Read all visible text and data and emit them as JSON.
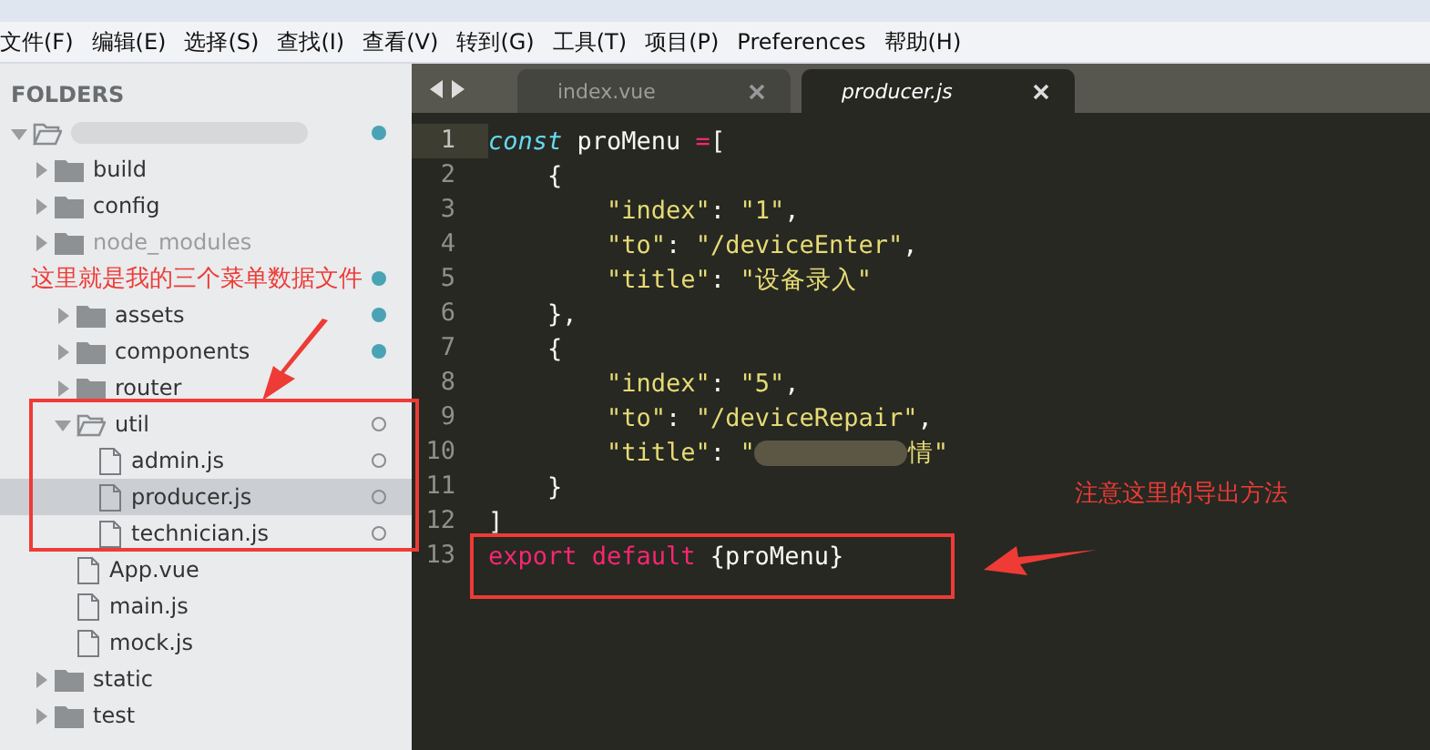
{
  "menu_bar": [
    "文件(F)",
    "编辑(E)",
    "选择(S)",
    "查找(I)",
    "查看(V)",
    "转到(G)",
    "工具(T)",
    "项目(P)",
    "Preferences",
    "帮助(H)"
  ],
  "sidebar": {
    "heading": "FOLDERS",
    "tree": [
      {
        "kind": "folder",
        "redacted": true,
        "expanded": true,
        "modified": true,
        "selected": false,
        "children": [
          {
            "kind": "folder",
            "label": "build",
            "expanded": false,
            "selected": false
          },
          {
            "kind": "folder",
            "label": "config",
            "expanded": false,
            "selected": false
          },
          {
            "kind": "folder",
            "label": "node_modules",
            "expanded": false,
            "dimmed": true,
            "selected": false
          },
          {
            "kind": "folder",
            "note": "这里就是我的三个菜单数据文件",
            "expanded": true,
            "modified": true,
            "selected": false,
            "children": [
              {
                "kind": "folder",
                "label": "assets",
                "expanded": false,
                "modified": true,
                "selected": false
              },
              {
                "kind": "folder",
                "label": "components",
                "expanded": false,
                "modified": true,
                "selected": false
              },
              {
                "kind": "folder",
                "label": "router",
                "expanded": false,
                "selected": false
              },
              {
                "kind": "folder",
                "label": "util",
                "expanded": true,
                "untracked": true,
                "selected": false,
                "children": [
                  {
                    "kind": "file",
                    "label": "admin.js",
                    "untracked": true,
                    "selected": false
                  },
                  {
                    "kind": "file",
                    "label": "producer.js",
                    "untracked": true,
                    "selected": true
                  },
                  {
                    "kind": "file",
                    "label": "technician.js",
                    "untracked": true,
                    "selected": false
                  }
                ]
              },
              {
                "kind": "file",
                "label": "App.vue",
                "selected": false
              },
              {
                "kind": "file",
                "label": "main.js",
                "selected": false
              },
              {
                "kind": "file",
                "label": "mock.js",
                "selected": false
              }
            ]
          },
          {
            "kind": "folder",
            "label": "static",
            "expanded": false,
            "selected": false
          },
          {
            "kind": "folder",
            "label": "test",
            "expanded": false,
            "selected": false
          }
        ]
      }
    ]
  },
  "tabs": [
    {
      "label": "index.vue",
      "selected": false
    },
    {
      "label": "producer.js",
      "selected": true
    }
  ],
  "editor": {
    "lines": [
      {
        "number": "1",
        "current": true,
        "tokens": [
          {
            "kind": "storage",
            "text": "const"
          },
          {
            "kind": "plain",
            "text": " proMenu "
          },
          {
            "kind": "operator",
            "text": "="
          },
          {
            "kind": "plain",
            "text": "["
          }
        ]
      },
      {
        "number": "2",
        "current": false,
        "tokens": [
          {
            "kind": "plain",
            "text": "    {"
          }
        ]
      },
      {
        "number": "3",
        "current": false,
        "tokens": [
          {
            "kind": "string",
            "text": "        \"index\""
          },
          {
            "kind": "plain",
            "text": ": "
          },
          {
            "kind": "string",
            "text": "\"1\""
          },
          {
            "kind": "plain",
            "text": ","
          }
        ]
      },
      {
        "number": "4",
        "current": false,
        "tokens": [
          {
            "kind": "string",
            "text": "        \"to\""
          },
          {
            "kind": "plain",
            "text": ": "
          },
          {
            "kind": "string",
            "text": "\"/deviceEnter\""
          },
          {
            "kind": "plain",
            "text": ","
          }
        ]
      },
      {
        "number": "5",
        "current": false,
        "tokens": [
          {
            "kind": "string",
            "text": "        \"title\""
          },
          {
            "kind": "plain",
            "text": ": "
          },
          {
            "kind": "string",
            "text": "\"设备录入\""
          }
        ]
      },
      {
        "number": "6",
        "current": false,
        "tokens": [
          {
            "kind": "plain",
            "text": "    },"
          }
        ]
      },
      {
        "number": "7",
        "current": false,
        "tokens": [
          {
            "kind": "plain",
            "text": "    {"
          }
        ]
      },
      {
        "number": "8",
        "current": false,
        "tokens": [
          {
            "kind": "string",
            "text": "        \"index\""
          },
          {
            "kind": "plain",
            "text": ": "
          },
          {
            "kind": "string",
            "text": "\"5\""
          },
          {
            "kind": "plain",
            "text": ","
          }
        ]
      },
      {
        "number": "9",
        "current": false,
        "tokens": [
          {
            "kind": "string",
            "text": "        \"to\""
          },
          {
            "kind": "plain",
            "text": ": "
          },
          {
            "kind": "string",
            "text": "\"/deviceRepair\""
          },
          {
            "kind": "plain",
            "text": ","
          }
        ]
      },
      {
        "number": "10",
        "current": false,
        "tokens": [
          {
            "kind": "string",
            "text": "        \"title\""
          },
          {
            "kind": "plain",
            "text": ": "
          },
          {
            "kind": "string",
            "text": "\""
          },
          {
            "kind": "redacted"
          },
          {
            "kind": "string",
            "text": "情\""
          }
        ]
      },
      {
        "number": "11",
        "current": false,
        "tokens": [
          {
            "kind": "plain",
            "text": "    }"
          }
        ]
      },
      {
        "number": "12",
        "current": false,
        "tokens": [
          {
            "kind": "plain",
            "text": "]"
          }
        ]
      },
      {
        "number": "13",
        "current": false,
        "tokens": [
          {
            "kind": "keyword",
            "text": "export default"
          },
          {
            "kind": "plain",
            "text": " {proMenu}"
          }
        ]
      }
    ]
  },
  "annotations": [
    {
      "kind": "code-note",
      "text": "注意这里的导出方法"
    }
  ]
}
